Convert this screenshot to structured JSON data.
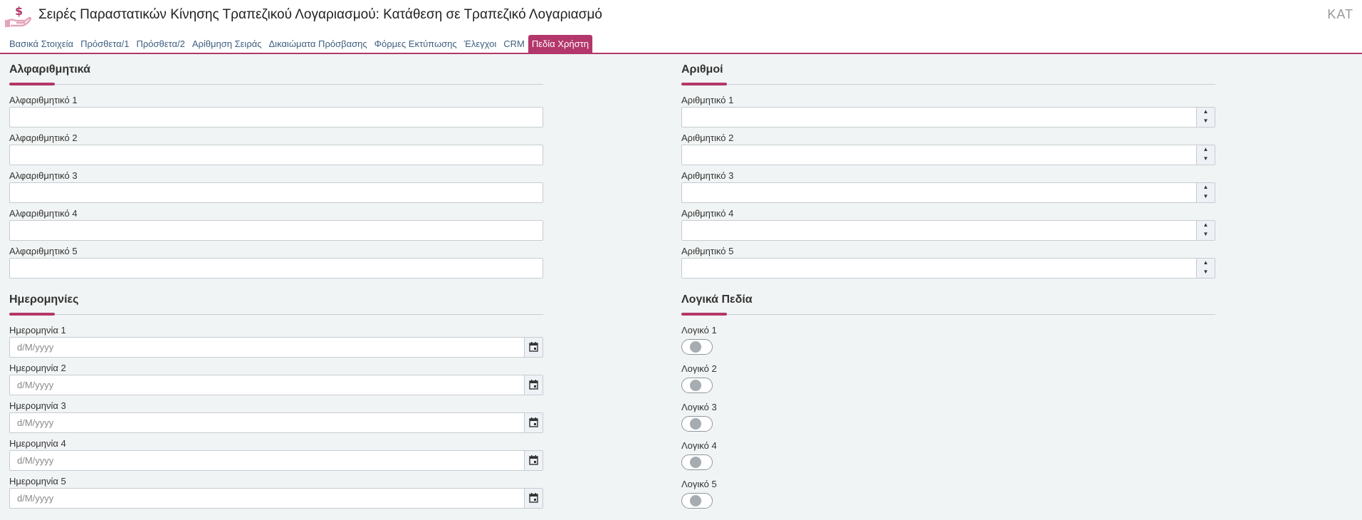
{
  "header": {
    "title": "Σειρές Παραστατικών Κίνησης Τραπεζικού Λογαριασμού: Κατάθεση σε Τραπεζικό Λογαριασμό",
    "corner": "ΚΑΤ",
    "logo_icon": "money-hand-icon"
  },
  "tabs": [
    {
      "label": "Βασικά Στοιχεία"
    },
    {
      "label": "Πρόσθετα/1"
    },
    {
      "label": "Πρόσθετα/2"
    },
    {
      "label": "Αρίθμηση Σειράς"
    },
    {
      "label": "Δικαιώματα Πρόσβασης"
    },
    {
      "label": "Φόρμες Εκτύπωσης"
    },
    {
      "label": "Έλεγχοι"
    },
    {
      "label": "CRM"
    },
    {
      "label": "Πεδία Χρήστη"
    }
  ],
  "active_tab": "Πεδία Χρήστη",
  "alphanumeric": {
    "title": "Αλφαριθμητικά",
    "fields": [
      {
        "label": "Αλφαριθμητικό 1",
        "value": ""
      },
      {
        "label": "Αλφαριθμητικό 2",
        "value": ""
      },
      {
        "label": "Αλφαριθμητικό 3",
        "value": ""
      },
      {
        "label": "Αλφαριθμητικό 4",
        "value": ""
      },
      {
        "label": "Αλφαριθμητικό 5",
        "value": ""
      }
    ]
  },
  "numbers": {
    "title": "Αριθμοί",
    "fields": [
      {
        "label": "Αριθμητικό 1",
        "value": ""
      },
      {
        "label": "Αριθμητικό 2",
        "value": ""
      },
      {
        "label": "Αριθμητικό 3",
        "value": ""
      },
      {
        "label": "Αριθμητικό 4",
        "value": ""
      },
      {
        "label": "Αριθμητικό 5",
        "value": ""
      }
    ]
  },
  "dates": {
    "title": "Ημερομηνίες",
    "fields": [
      {
        "label": "Ημερομηνία 1",
        "placeholder": "d/M/yyyy"
      },
      {
        "label": "Ημερομηνία 2",
        "placeholder": "d/M/yyyy"
      },
      {
        "label": "Ημερομηνία 3",
        "placeholder": "d/M/yyyy"
      },
      {
        "label": "Ημερομηνία 4",
        "placeholder": "d/M/yyyy"
      },
      {
        "label": "Ημερομηνία 5",
        "placeholder": "d/M/yyyy"
      }
    ]
  },
  "booleans": {
    "title": "Λογικά Πεδία",
    "fields": [
      {
        "label": "Λογικό 1",
        "checked": false
      },
      {
        "label": "Λογικό 2",
        "checked": false
      },
      {
        "label": "Λογικό 3",
        "checked": false
      },
      {
        "label": "Λογικό 4",
        "checked": false
      },
      {
        "label": "Λογικό 5",
        "checked": false
      }
    ]
  },
  "colors": {
    "accent": "#b3376b",
    "tab_text": "#3f5f7f",
    "content_bg": "#f1f4f4"
  },
  "icons": {
    "spinner_up": "▲",
    "spinner_down": "▼",
    "calendar": "calendar-icon"
  }
}
